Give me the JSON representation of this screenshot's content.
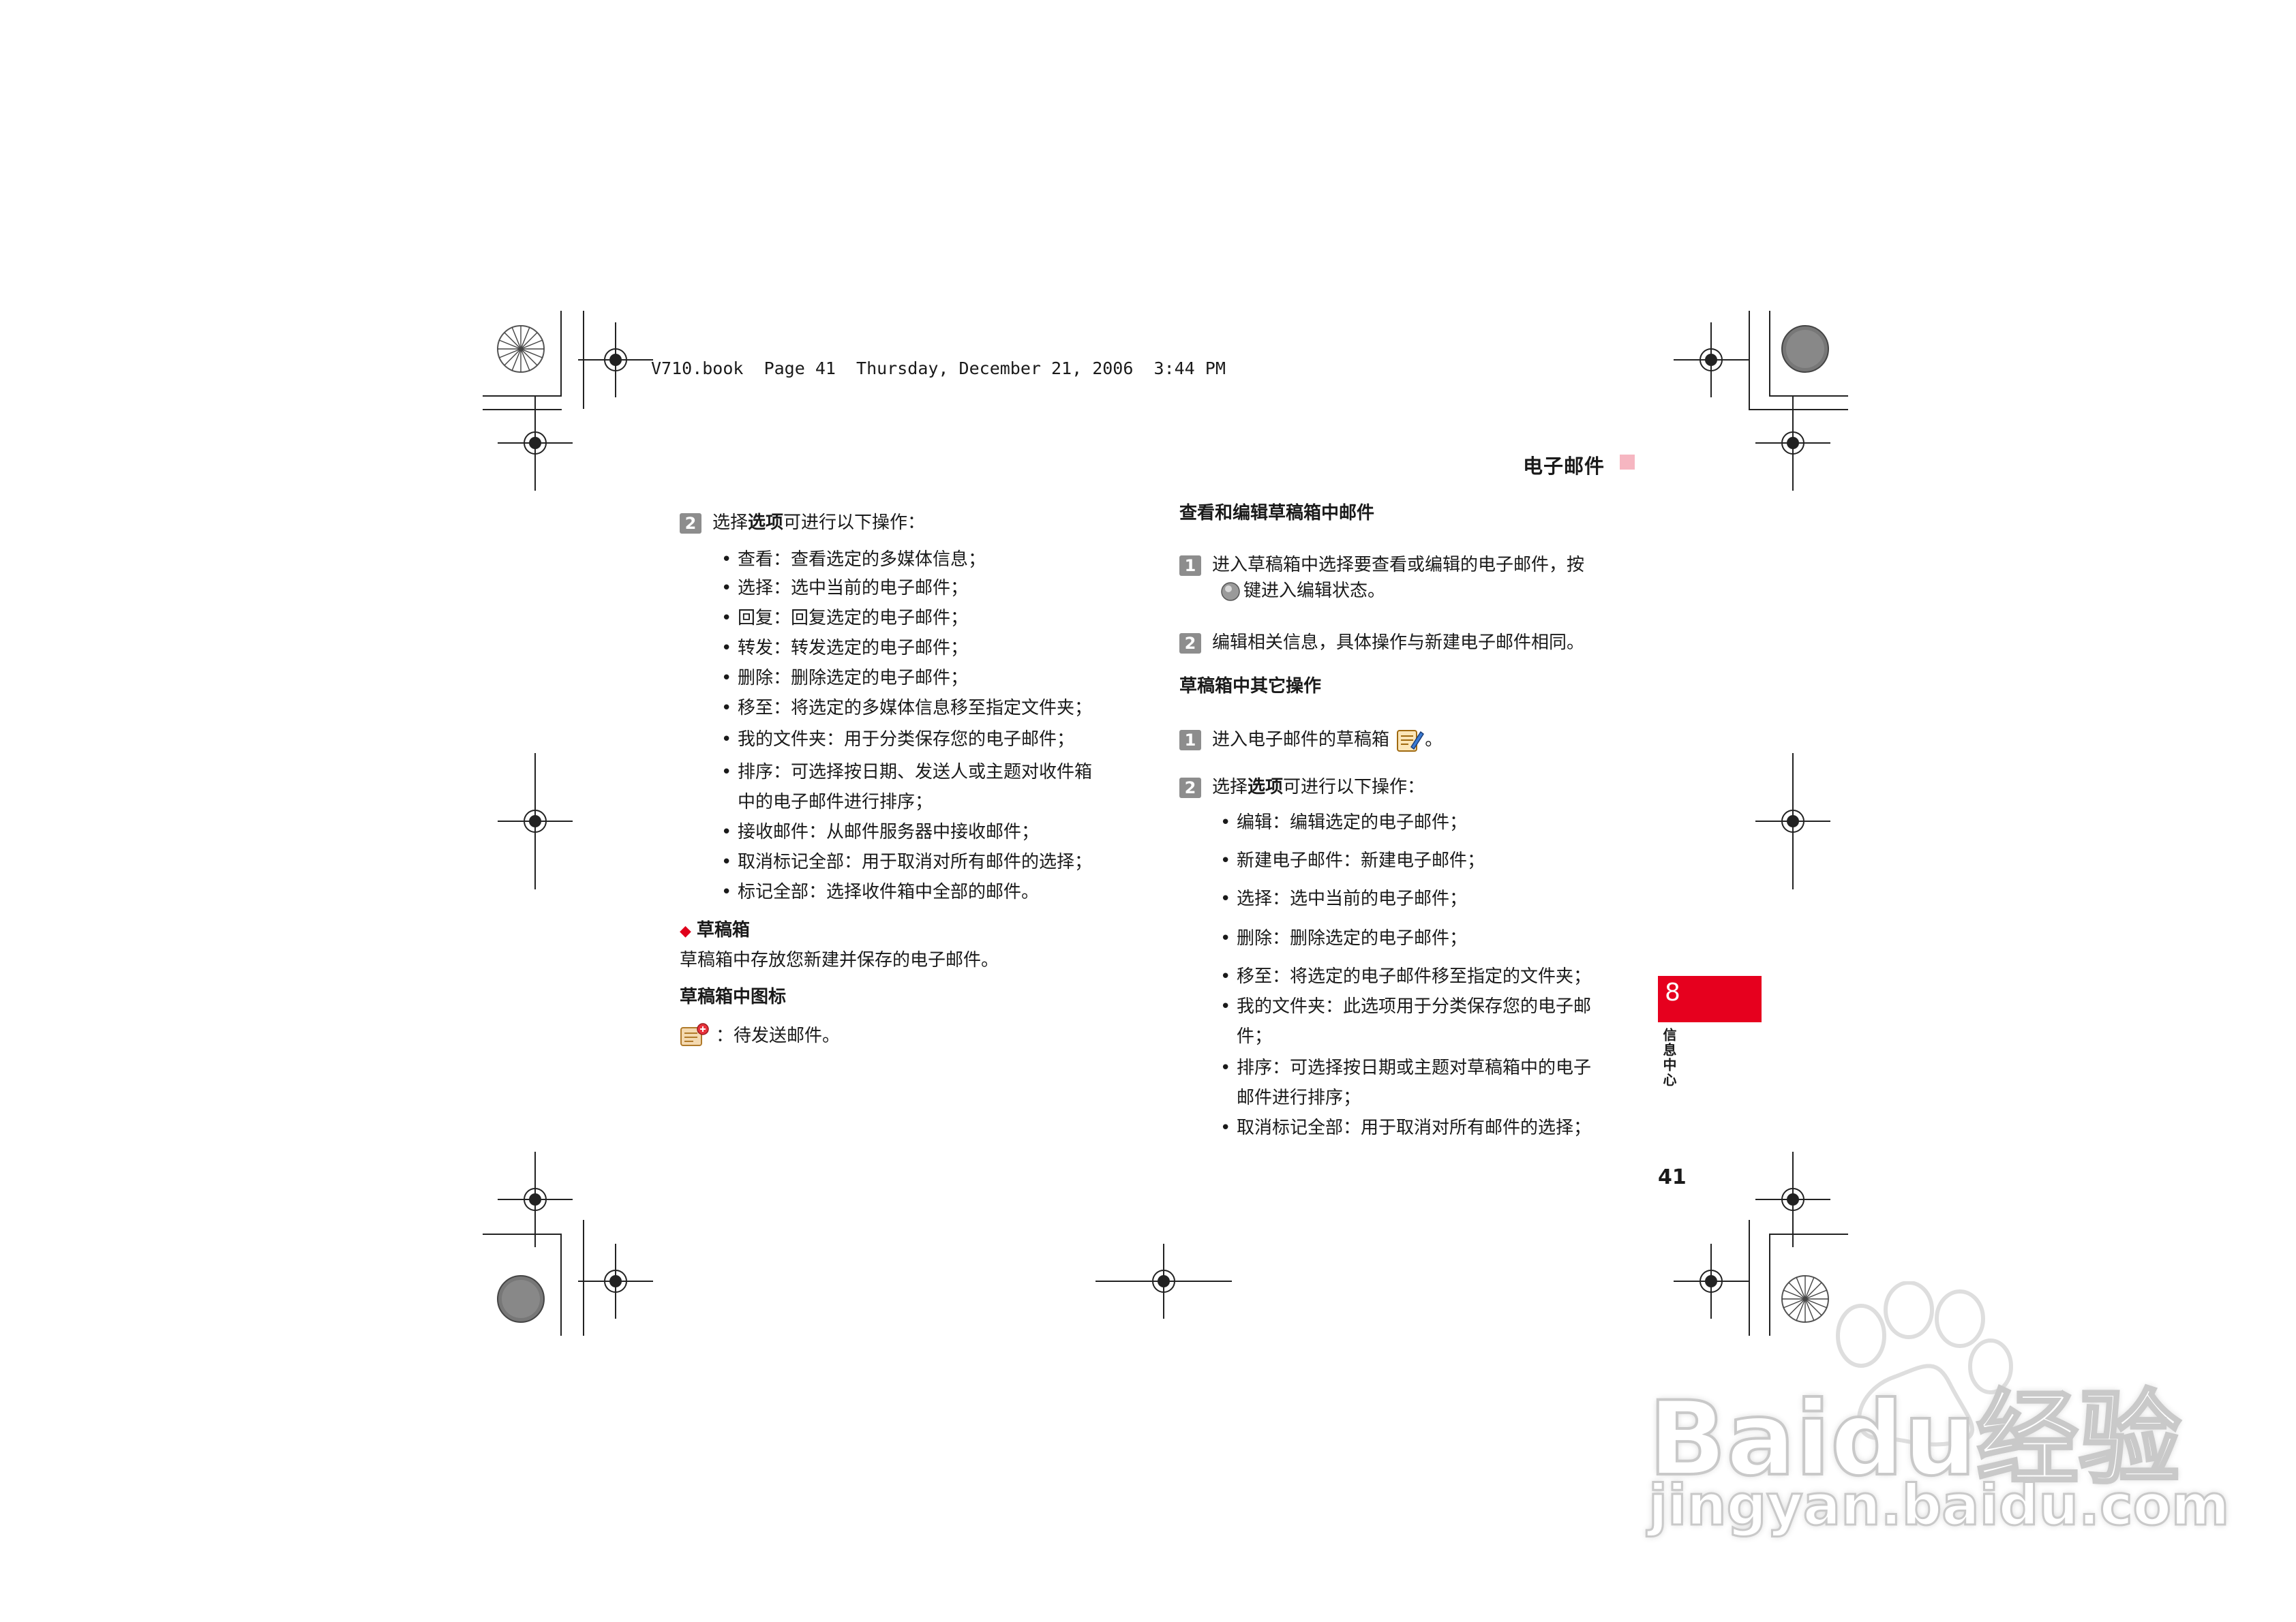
{
  "book_header": "V710.book  Page 41  Thursday, December 21, 2006  3:44 PM",
  "running_header": "电子邮件",
  "left_column": {
    "step2": {
      "num": "2",
      "prefix": "选择",
      "bold": "选项",
      "suffix": "可进行以下操作："
    },
    "bullets": [
      "查看：查看选定的多媒体信息；",
      "选择：选中当前的电子邮件；",
      "回复：回复选定的电子邮件；",
      "转发：转发选定的电子邮件；",
      "删除：删除选定的电子邮件；",
      "移至：将选定的多媒体信息移至指定文件夹；",
      "我的文件夹：用于分类保存您的电子邮件；",
      "排序：可选择按日期、发送人或主题对收件箱",
      "接收邮件：从邮件服务器中接收邮件；",
      "取消标记全部：用于取消对所有邮件的选择；",
      "标记全部：选择收件箱中全部的邮件。"
    ],
    "bullet_cont": "中的电子邮件进行排序；",
    "drafts_title": "草稿箱",
    "drafts_desc": "草稿箱中存放您新建并保存的电子邮件。",
    "icons_heading": "草稿箱中图标",
    "icon_desc": "：待发送邮件。"
  },
  "right_column": {
    "heading1": "查看和编辑草稿箱中邮件",
    "step1": {
      "num": "1",
      "line1": "进入草稿箱中选择要查看或编辑的电子邮件，按",
      "line2": "键进入编辑状态。"
    },
    "step2": {
      "num": "2",
      "text": "编辑相关信息，具体操作与新建电子邮件相同。"
    },
    "heading2": "草稿箱中其它操作",
    "step1b": {
      "num": "1",
      "text": "进入电子邮件的草稿箱",
      "suffix": "。"
    },
    "step2b": {
      "num": "2",
      "prefix": "选择",
      "bold": "选项",
      "suffix": "可进行以下操作："
    },
    "bullets": [
      "编辑：编辑选定的电子邮件；",
      "新建电子邮件：新建电子邮件；",
      "选择：选中当前的电子邮件；",
      "删除：删除选定的电子邮件；",
      "移至：将选定的电子邮件移至指定的文件夹；",
      "我的文件夹：此选项用于分类保存您的电子邮",
      "排序：可选择按日期或主题对草稿箱中的电子",
      "取消标记全部：用于取消对所有邮件的选择；"
    ],
    "bullet_conts": [
      "件；",
      "邮件进行排序；"
    ]
  },
  "side_tab": {
    "number": "8",
    "label": "信息中心"
  },
  "page_number": "41",
  "watermark": {
    "brand": "Baidu经验",
    "url": "jingyan.baidu.com"
  },
  "colors": {
    "accent": "#e6001e",
    "pink": "#f6b6c1",
    "step_gray": "#8d8d8d"
  }
}
